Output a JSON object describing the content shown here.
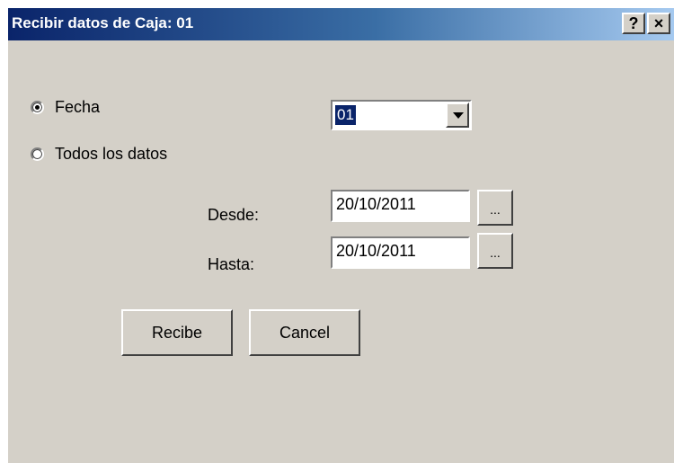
{
  "window": {
    "title": "Recibir datos de Caja: 01",
    "help_label": "?",
    "close_label": "×"
  },
  "options": {
    "fecha_label": "Fecha",
    "todos_label": "Todos los datos",
    "selected": "Fecha"
  },
  "caja_select": {
    "value": "01"
  },
  "range": {
    "desde_label": "Desde:",
    "desde_value": "20/10/2011",
    "hasta_label": "Hasta:",
    "hasta_value": "20/10/2011",
    "picker_label": "..."
  },
  "buttons": {
    "recibe_label": "Recibe",
    "cancel_label": "Cancel"
  },
  "colors": {
    "titlebar_start": "#0a246a",
    "titlebar_end": "#a6caf0",
    "dialog_bg": "#d4d0c8"
  }
}
